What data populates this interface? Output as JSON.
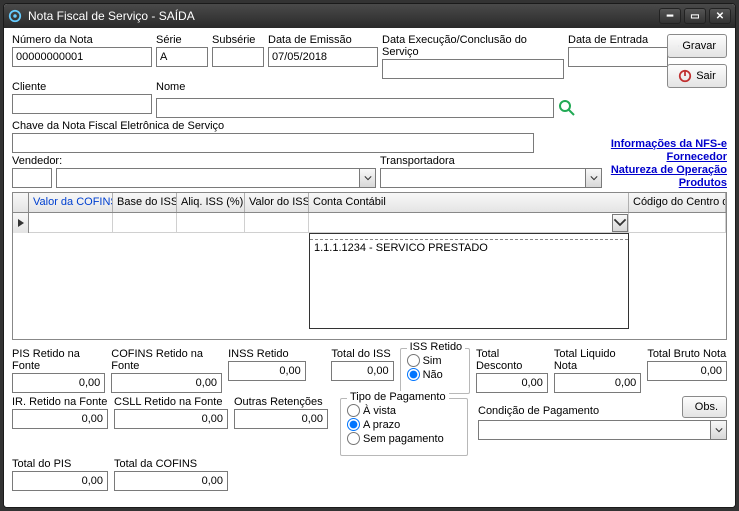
{
  "window": {
    "title": "Nota Fiscal de Serviço - SAÍDA"
  },
  "fields": {
    "numero_nota": {
      "label": "Número da Nota",
      "value": "00000000001"
    },
    "serie": {
      "label": "Série",
      "value": "A"
    },
    "subserie": {
      "label": "Subsérie",
      "value": ""
    },
    "data_emissao": {
      "label": "Data de Emissão",
      "value": "07/05/2018"
    },
    "data_execucao": {
      "label": "Data Execução/Conclusão do Serviço",
      "value": ""
    },
    "data_entrada": {
      "label": "Data de Entrada",
      "value": ""
    },
    "cliente": {
      "label": "Cliente",
      "value": ""
    },
    "nome": {
      "label": "Nome",
      "value": ""
    },
    "chave": {
      "label": "Chave da Nota Fiscal Eletrônica de Serviço",
      "value": ""
    },
    "vendedor": {
      "label": "Vendedor:",
      "value": ""
    },
    "transportadora": {
      "label": "Transportadora",
      "value": ""
    }
  },
  "buttons": {
    "gravar": "Gravar",
    "sair": "Sair",
    "obs": "Obs."
  },
  "links": {
    "info_nfse": "Informações da NFS-e",
    "fornecedor": "Fornecedor",
    "natureza": "Natureza de Operação",
    "produtos": "Produtos"
  },
  "grid": {
    "headers": {
      "valor_cofins": "Valor da COFINS",
      "base_iss": "Base do ISS",
      "aliq_iss": "Aliq. ISS (%)",
      "valor_iss": "Valor do ISS",
      "conta_contabil": "Conta Contábil",
      "codigo_centro": "Código do Centro de Cu"
    },
    "dropdown_item": "1.1.1.1234 - SERVICO PRESTADO"
  },
  "totals": {
    "pis_retido": {
      "label": "PIS Retido na Fonte",
      "value": "0,00"
    },
    "cofins_retido": {
      "label": "COFINS Retido na Fonte",
      "value": "0,00"
    },
    "inss_retido": {
      "label": "INSS Retido",
      "value": "0,00"
    },
    "total_iss": {
      "label": "Total do ISS",
      "value": "0,00"
    },
    "ir_retido": {
      "label": "IR. Retido na Fonte",
      "value": "0,00"
    },
    "csll_retido": {
      "label": "CSLL Retido na Fonte",
      "value": "0,00"
    },
    "outras_ret": {
      "label": "Outras Retenções",
      "value": "0,00"
    },
    "total_pis": {
      "label": "Total do PIS",
      "value": "0,00"
    },
    "total_cofins": {
      "label": "Total da COFINS",
      "value": "0,00"
    },
    "total_desconto": {
      "label": "Total Desconto",
      "value": "0,00"
    },
    "total_liquido": {
      "label": "Total Liquido Nota",
      "value": "0,00"
    },
    "total_bruto": {
      "label": "Total Bruto Nota",
      "value": "0,00"
    }
  },
  "iss_retido": {
    "title": "ISS Retido",
    "sim": "Sim",
    "nao": "Não"
  },
  "tipo_pagamento": {
    "title": "Tipo de Pagamento",
    "avista": "À vista",
    "aprazo": "A prazo",
    "sem": "Sem pagamento"
  },
  "condicao_pagamento": {
    "label": "Condição de Pagamento",
    "value": ""
  }
}
